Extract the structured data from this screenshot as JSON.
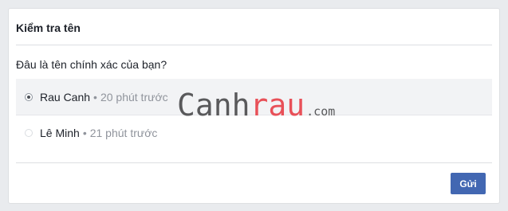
{
  "dialog": {
    "title": "Kiểm tra tên",
    "question": "Đâu là tên chính xác của bạn?",
    "options": [
      {
        "name": "Rau Canh",
        "separator": "•",
        "time": "20 phút trước",
        "selected": true
      },
      {
        "name": "Lê Minh",
        "separator": "•",
        "time": "21 phút trước",
        "selected": false
      }
    ],
    "submit_label": "Gửi"
  },
  "watermark": {
    "part1": "Canh",
    "part2": "rau",
    "part3": ".com"
  },
  "colors": {
    "page_bg": "#e9ebee",
    "card_bg": "#ffffff",
    "accent": "#4267b2",
    "muted_text": "#90949c",
    "watermark_red": "#e85058",
    "watermark_gray": "#59595b"
  }
}
